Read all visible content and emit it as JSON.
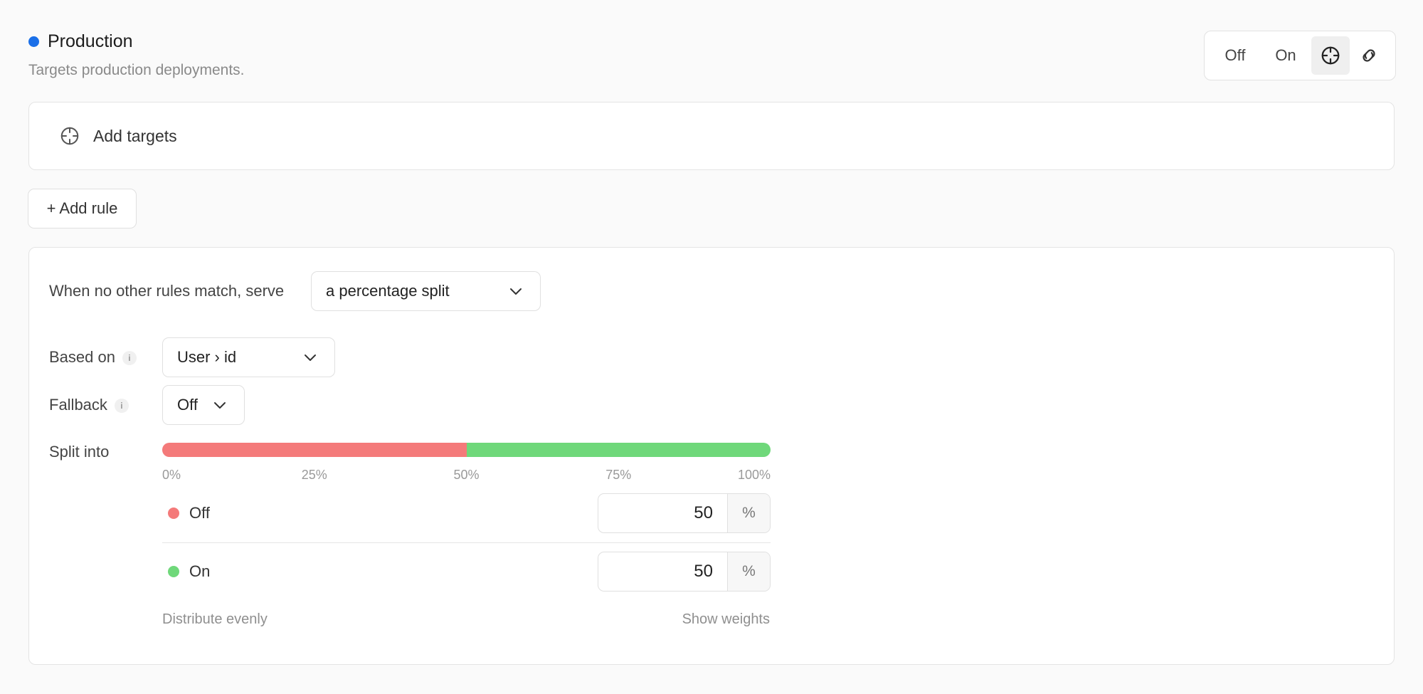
{
  "environment": {
    "title": "Production",
    "description": "Targets production deployments.",
    "dot_color": "#1a6fe8"
  },
  "mode_switch": {
    "off_label": "Off",
    "on_label": "On",
    "icons": [
      "crosshair-icon",
      "link-icon"
    ],
    "active": "crosshair-icon"
  },
  "targets": {
    "icon": "crosshair-icon",
    "label": "Add targets"
  },
  "add_rule_label": "+ Add rule",
  "default_rule": {
    "serve_label": "When no other rules match, serve",
    "serve_value": "a percentage split",
    "based_on_label": "Based on",
    "based_on_value": "User › id",
    "fallback_label": "Fallback",
    "fallback_value": "Off",
    "split_label": "Split into",
    "ticks": [
      "0%",
      "25%",
      "50%",
      "75%",
      "100%"
    ],
    "variations": [
      {
        "name": "Off",
        "value": "50",
        "unit": "%",
        "color": "#f47a7a",
        "percent": 50
      },
      {
        "name": "On",
        "value": "50",
        "unit": "%",
        "color": "#6fd87a",
        "percent": 50
      }
    ],
    "distribute_label": "Distribute evenly",
    "weights_label": "Show weights"
  }
}
